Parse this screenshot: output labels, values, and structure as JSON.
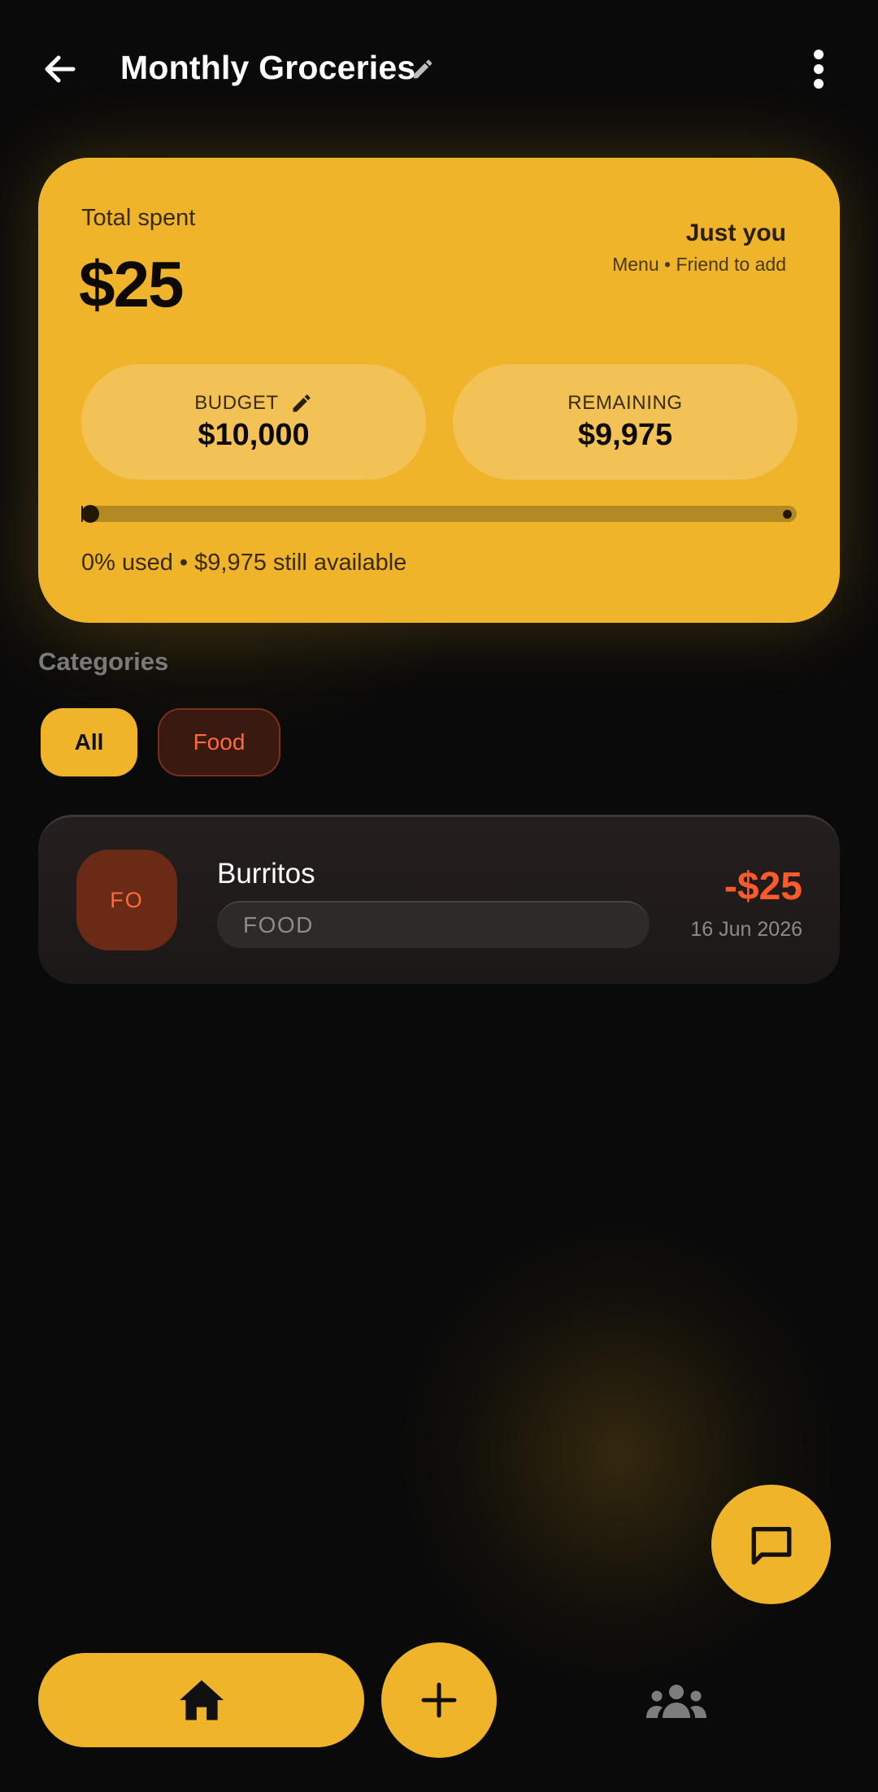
{
  "header": {
    "title": "Monthly Groceries",
    "back_icon": "arrow-left-icon",
    "edit_icon": "pencil-icon",
    "more_icon": "more-vertical-icon"
  },
  "summary": {
    "total_label": "Total spent",
    "total_value": "$25",
    "share_title": "Just you",
    "share_subtitle": "Menu • Friend to add",
    "budget_label": "BUDGET",
    "budget_value": "$10,000",
    "remaining_label": "REMAINING",
    "remaining_value": "$9,975",
    "progress_fraction": 0.0025,
    "usage_text": "0% used • $9,975 still available"
  },
  "categories": {
    "label": "Categories",
    "chips": [
      {
        "label": "All",
        "selected": true
      },
      {
        "label": "Food",
        "selected": false
      }
    ]
  },
  "transactions": [
    {
      "avatar_initials": "FO",
      "name": "Burritos",
      "category_tag": "FOOD",
      "amount": "-$25",
      "date": "16 Jun 2026"
    }
  ],
  "fab": {
    "icon": "chat-icon"
  },
  "bottom_nav": {
    "home_icon": "home-icon",
    "add_icon": "plus-icon",
    "people_icon": "people-icon"
  },
  "colors": {
    "accent": "#efb42a",
    "background": "#0a0a0a",
    "expense": "#ff5a2c",
    "food_chip": "#ff6a3d"
  }
}
